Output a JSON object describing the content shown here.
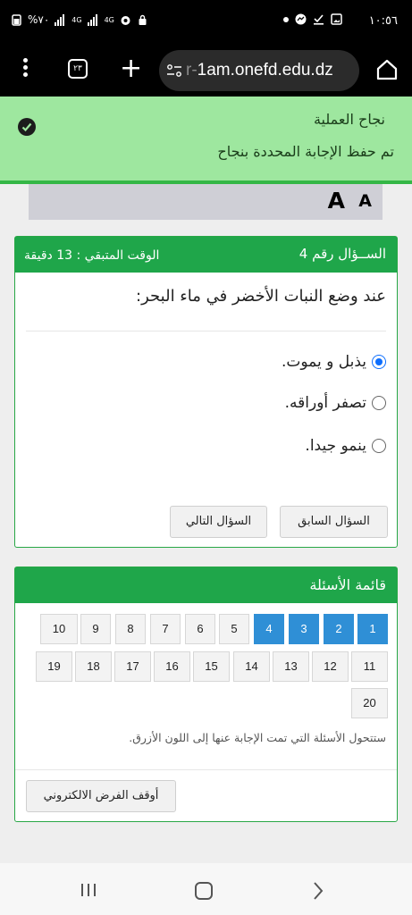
{
  "status_bar": {
    "time": "١٠:٥٦",
    "battery": "%٧٠",
    "net1": "4G",
    "net2": "4G"
  },
  "browser": {
    "tab_count": "٢٣",
    "url_dim": "r-",
    "url_main": "1am.onefd.edu.dz"
  },
  "banner": {
    "title": "نجاح العملية",
    "message": "تم حفظ الإجابة المحددة بنجاح"
  },
  "font_controls": {
    "large": "A",
    "small": "A"
  },
  "question": {
    "number_label": "الســؤال رقم 4",
    "time_left": "الوقت المتبقي : 13 دقيقة",
    "text": "عند وضع النبات الأخضر في ماء البحر:",
    "options": [
      {
        "label": "يذبل و يموت.",
        "selected": true
      },
      {
        "label": "تصفر أوراقه.",
        "selected": false
      },
      {
        "label": "ينمو جيدا.",
        "selected": false
      }
    ],
    "prev_button": "السؤال السابق",
    "next_button": "السؤال التالي"
  },
  "question_list": {
    "title": "قائمة الأسئلة",
    "rows": [
      [
        "1",
        "2",
        "3",
        "4",
        "5",
        "6",
        "7",
        "8",
        "9",
        "10"
      ],
      [
        "11",
        "12",
        "13",
        "14",
        "15",
        "16",
        "17",
        "18",
        "19"
      ],
      [
        "20"
      ]
    ],
    "answered": [
      "1",
      "2",
      "3",
      "4"
    ],
    "note": "ستتحول الأسئلة التي تمت الإجابة عنها إلى اللون الأزرق.",
    "stop_button": "أوقف الفرض الالكتروني"
  },
  "colors": {
    "accent_green": "#1fa64a",
    "answered_blue": "#2f8fd6",
    "banner_bg": "#9ee79f"
  }
}
